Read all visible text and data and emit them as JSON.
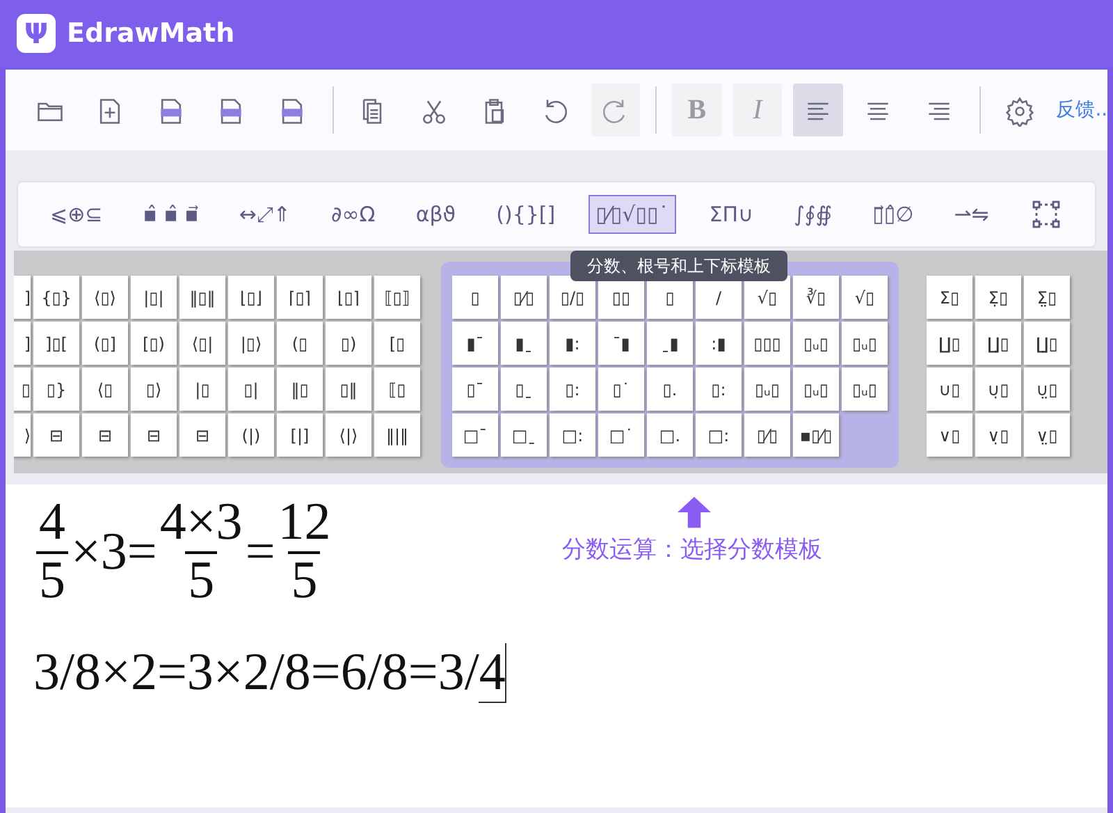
{
  "window": {
    "logo": "Ψ",
    "title": "EdrawMath"
  },
  "toolbar": [
    {
      "kind": "open",
      "disabled": false,
      "selected": false
    },
    {
      "kind": "new",
      "disabled": false,
      "selected": false
    },
    {
      "kind": "export",
      "disabled": false,
      "selected": false
    },
    {
      "kind": "export",
      "disabled": false,
      "selected": false
    },
    {
      "kind": "export",
      "disabled": false,
      "selected": false
    },
    {
      "kind": "sep"
    },
    {
      "kind": "copy",
      "disabled": false,
      "selected": false
    },
    {
      "kind": "cut",
      "disabled": false,
      "selected": false
    },
    {
      "kind": "paste",
      "disabled": false,
      "selected": false
    },
    {
      "kind": "undo",
      "disabled": false,
      "selected": false
    },
    {
      "kind": "redo",
      "disabled": true,
      "selected": false
    },
    {
      "kind": "sep"
    },
    {
      "kind": "bold",
      "label": "B",
      "disabled": true,
      "selected": false
    },
    {
      "kind": "italic",
      "label": "I",
      "disabled": true,
      "selected": false
    },
    {
      "kind": "align-left",
      "disabled": false,
      "selected": true
    },
    {
      "kind": "align-center",
      "disabled": false,
      "selected": false
    },
    {
      "kind": "align-right",
      "disabled": false,
      "selected": false
    },
    {
      "kind": "sep"
    },
    {
      "kind": "settings",
      "disabled": false,
      "selected": false
    }
  ],
  "feedback": "反馈..",
  "categories": [
    {
      "kind": "text",
      "label": "⩽⊕⊆",
      "selected": false
    },
    {
      "kind": "text",
      "label": "▪̂ ▪̂ ▪⃗",
      "selected": false
    },
    {
      "kind": "text",
      "label": "↔⤢⇑",
      "selected": false
    },
    {
      "kind": "text",
      "label": "∂∞Ω",
      "selected": false
    },
    {
      "kind": "text",
      "label": "αβϑ",
      "selected": false
    },
    {
      "kind": "text",
      "label": "(){}[]",
      "selected": false
    },
    {
      "kind": "text",
      "label": "▯⁄▯√▯▯˙",
      "selected": true
    },
    {
      "kind": "text",
      "label": "ΣΠ∪",
      "selected": false
    },
    {
      "kind": "text",
      "label": "∫∮∯",
      "selected": false
    },
    {
      "kind": "text",
      "label": "▯⃗▯̂∅",
      "selected": false
    },
    {
      "kind": "text",
      "label": "⇀⇋",
      "selected": false
    },
    {
      "kind": "matrix",
      "selected": false
    }
  ],
  "tooltip": "分数、根号和上下标模板",
  "palette": {
    "left": [
      [
        "]",
        "{▯}",
        "⟨▯⟩",
        "|▯|",
        "‖▯‖",
        "⌊▯⌋",
        "⌈▯⌉",
        "⌊▯⌉",
        "⟦▯⟧"
      ],
      [
        "]",
        "]▯[",
        "(▯]",
        "[▯)",
        "⟨▯|",
        "|▯⟩",
        "(▯",
        "▯)",
        "[▯"
      ],
      [
        "▯",
        "▯}",
        "⟨▯",
        "▯⟩",
        "|▯",
        "▯|",
        "‖▯",
        "▯‖",
        "⟦▯"
      ],
      [
        "⟩",
        "⊟",
        "⊟",
        "⊟",
        "⊟",
        "(|)",
        "[|]",
        "⟨|⟩",
        "‖|‖"
      ]
    ],
    "middle": [
      [
        "▯",
        "▯⁄▯",
        "▯/▯",
        "▯▯",
        "▯",
        "/",
        "√▯",
        "∛▯",
        "√▯"
      ],
      [
        "▮ˉ",
        "▮ˍ",
        "▮:",
        "ˉ▮",
        "ˍ▮",
        ":▮",
        "▯▯▯",
        "▯ᵤ▯",
        "▯ᵤ▯"
      ],
      [
        "▯ˉ",
        "▯ˍ",
        "▯:",
        "▯˙",
        "▯.",
        "▯:",
        "▯ᵤ▯",
        "▯ᵤ▯",
        "▯ᵤ▯"
      ],
      [
        "□ˉ",
        "□ˍ",
        "□:",
        "□˙",
        "□.",
        "□:",
        "▯⁄▯",
        "▪▯⁄▯"
      ]
    ],
    "right": [
      [
        "Σ▯",
        "Σ̣▯",
        "Σ̤▯"
      ],
      [
        "∐▯",
        "∐̣▯",
        "∐̤▯"
      ],
      [
        "∪▯",
        "∪̣▯",
        "∪̤▯"
      ],
      [
        "∨▯",
        "∨̣▯",
        "∨̤▯"
      ]
    ]
  },
  "equations": [
    {
      "parts": [
        {
          "kind": "frac",
          "num": "4",
          "den": "5"
        },
        {
          "kind": "text",
          "text": "×3="
        },
        {
          "kind": "frac",
          "num": "4×3",
          "den": "5"
        },
        {
          "kind": "text",
          "text": "="
        },
        {
          "kind": "frac",
          "num": "12",
          "den": "5"
        }
      ]
    },
    {
      "parts": [
        {
          "kind": "text",
          "text": "3/8×2=3×2/8=6/8=3/"
        },
        {
          "kind": "slot",
          "text": "4"
        }
      ]
    }
  ],
  "annotation": "分数运算：选择分数模板"
}
